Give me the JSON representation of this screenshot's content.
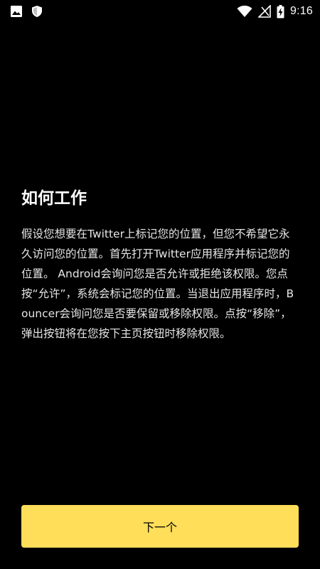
{
  "status_bar": {
    "time": "9:16",
    "left_icons": [
      "image-icon",
      "shield-icon"
    ],
    "right_icons": [
      "wifi-icon",
      "no-signal-icon",
      "battery-charging-icon"
    ]
  },
  "content": {
    "title": "如何工作",
    "body": "假设您想要在Twitter上标记您的位置，但您不希望它永久访问您的位置。首先打开Twitter应用程序并标记您的位置。 Android会询问您是否允许或拒绝该权限。您点按“允许”，系统会标记您的位置。当退出应用程序时，Bouncer会询问您是否要保留或移除权限。点按“移除”，弹出按钮将在您按下主页按钮时移除权限。"
  },
  "footer": {
    "next_label": "下一个"
  },
  "colors": {
    "background": "#000000",
    "button_background": "#ffde59",
    "button_text": "#000000",
    "text": "#ffffff"
  }
}
